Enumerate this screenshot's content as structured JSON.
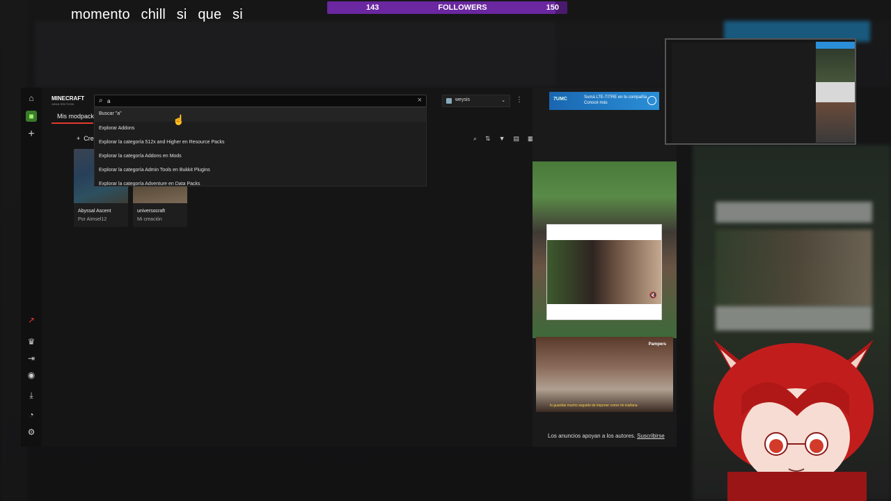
{
  "overlay": {
    "stream_title": "momento chill si que si",
    "followers": {
      "current": "143",
      "label": "FOLLOWERS",
      "goal": "150",
      "progress": 0.95
    }
  },
  "app": {
    "logo": {
      "line1": "MINECRAFT",
      "line2": "JAVA EDITION"
    },
    "search": {
      "value": "a",
      "placeholder": ""
    },
    "account": {
      "name": "weysis"
    },
    "tab": "Mis modpacks",
    "create_label": "Crear",
    "suggestions": [
      "Buscar \"a\"",
      "Explorar Addons",
      "Explorar la categoría 512x and Higher en Resource Packs",
      "Explorar la categoría Addons en Mods",
      "Explorar la categoría Admin Tools en Bukkit Plugins",
      "Explorar la categoría Adventure en Data Packs"
    ],
    "modpacks": [
      {
        "name": "Abyssal Ascent",
        "author": "Por Aimsel12"
      },
      {
        "name": "universocraft",
        "author": "Mi creación"
      }
    ],
    "ads": {
      "banner_brand": "7UMC",
      "banner_text": "Sumá LTE-TITRE en tu compañía",
      "banner_cta": "Conocé más",
      "bottom_brand": "Pampers",
      "bottom_caption": "lo guardás mucho seguido de imponer correr mi mañana",
      "footer_text": "Los anuncios apoyan a los autores.",
      "footer_link": "Suscribirse"
    }
  },
  "icons": {
    "home": "home-icon",
    "minecraft": "minecraft-icon",
    "plus": "plus-icon",
    "crown": "crown-icon",
    "login": "login-icon",
    "discord": "discord-icon",
    "download": "download-icon",
    "curseforge": "curseforge-icon",
    "settings": "gear-icon"
  },
  "colors": {
    "accent": "#e13a2b",
    "followers_bar": "#6a27a0",
    "minecraft_green": "#3b7a2a"
  }
}
